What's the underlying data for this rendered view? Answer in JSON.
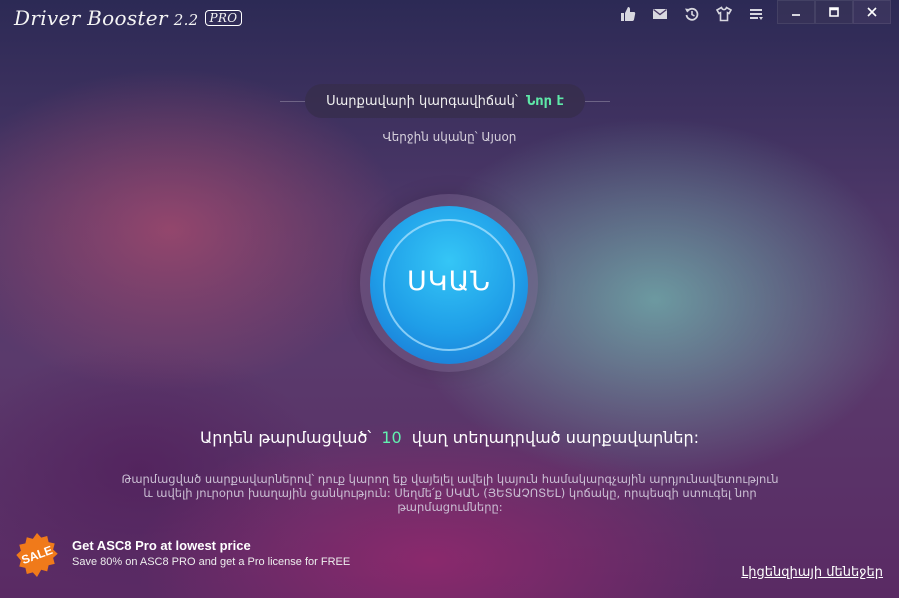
{
  "app": {
    "title": "Driver Booster",
    "version": "2.2",
    "badge": "PRO"
  },
  "toolbar": {
    "icons": [
      "thumbs-up-icon",
      "mail-icon",
      "history-icon",
      "shirt-icon",
      "menu-icon"
    ]
  },
  "window_controls": [
    "minimize-icon",
    "maximize-icon",
    "close-icon"
  ],
  "status": {
    "label": "Սարքավարի կարգավիճակ՝",
    "value": "Նոր է",
    "value_color": "#5ee8a8",
    "last_scan": "Վերջին սկանը՝ Այսօր"
  },
  "scan_button": {
    "label": "ՍԿԱՆ",
    "color": "#1f9ee8"
  },
  "drivers": {
    "prefix": "Արդեն թարմացված՝",
    "count": "10",
    "suffix": "վաղ տեղադրված սարքավարներ:",
    "count_color": "#62f0b0"
  },
  "description": "Թարմացված սարքավարներով՝ դուք կարող եք վայելել ավելի կայուն համակարգչային արդյունավետություն և ավելի յուրօրտ խաղային ցանկություն: Սեղմե՛ք ՍԿԱՆ (ՅԵՏԱՉՈՏԵԼ) կոճակը, որպեսզի ստուգել նոր թարմացումները:",
  "promo": {
    "badge": "SALE",
    "badge_color": "#f07a1a",
    "title": "Get ASC8 Pro at lowest price",
    "description": "Save 80% on ASC8 PRO and get a Pro license for FREE"
  },
  "license_link": "Լիցենզիայի մենեջեր"
}
